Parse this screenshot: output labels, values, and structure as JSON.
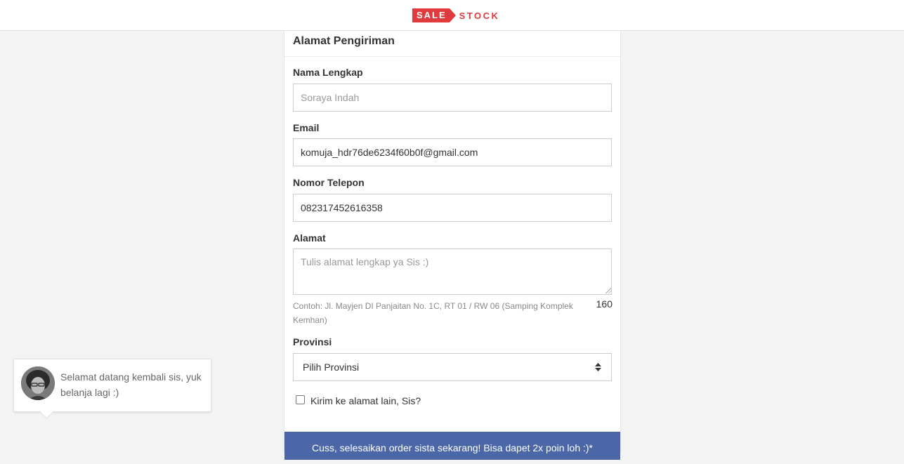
{
  "brand": {
    "part1": "SALE",
    "part2": "STOCK",
    "accent": "#e03a3e"
  },
  "form": {
    "title": "Alamat Pengiriman",
    "name": {
      "label": "Nama Lengkap",
      "placeholder": "Soraya Indah",
      "value": ""
    },
    "email": {
      "label": "Email",
      "value": "komuja_hdr76de6234f60b0f@gmail.com"
    },
    "phone": {
      "label": "Nomor Telepon",
      "value": "082317452616358"
    },
    "address": {
      "label": "Alamat",
      "placeholder": "Tulis alamat lengkap ya Sis :)",
      "hint": "Contoh: Jl. Mayjen DI Panjaitan No. 1C, RT 01 / RW 06 (Samping Komplek Kemhan)",
      "counter": "160"
    },
    "province": {
      "label": "Provinsi",
      "selected": "Pilih Provinsi"
    },
    "alt_address": {
      "label": "Kirim ke alamat lain, Sis?",
      "checked": false
    },
    "cta": {
      "label": "Cuss, selesaikan order sista sekarang! Bisa dapet 2x poin loh :)*",
      "color": "#4b67a8"
    }
  },
  "chat_bubble": {
    "message": "Selamat datang kembali sis, yuk belanja lagi :)",
    "icon": "avatar"
  }
}
